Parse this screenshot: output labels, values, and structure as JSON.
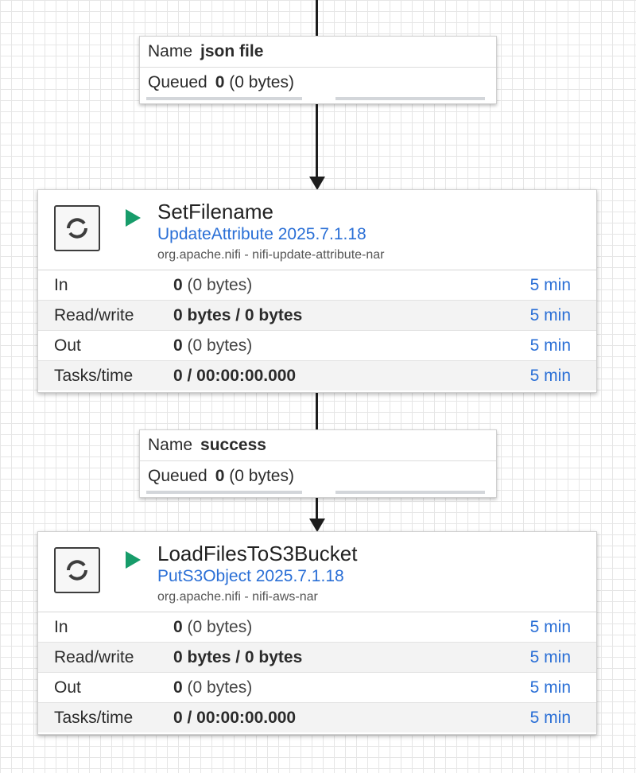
{
  "connections": [
    {
      "name_label": "Name",
      "name": "json file",
      "queued_label": "Queued",
      "queued_count": "0",
      "queued_size": "(0 bytes)"
    },
    {
      "name_label": "Name",
      "name": "success",
      "queued_label": "Queued",
      "queued_count": "0",
      "queued_size": "(0 bytes)"
    }
  ],
  "processors": [
    {
      "name": "SetFilename",
      "type": "UpdateAttribute 2025.7.1.18",
      "bundle": "org.apache.nifi - nifi-update-attribute-nar",
      "status": "running",
      "icon": "processor-icon",
      "stats": {
        "in": {
          "label": "In",
          "count": "0",
          "size": "(0 bytes)",
          "time": "5 min"
        },
        "rw": {
          "label": "Read/write",
          "value": "0 bytes / 0 bytes",
          "time": "5 min"
        },
        "out": {
          "label": "Out",
          "count": "0",
          "size": "(0 bytes)",
          "time": "5 min"
        },
        "tasks": {
          "label": "Tasks/time",
          "value": "0 / 00:00:00.000",
          "time": "5 min"
        }
      }
    },
    {
      "name": "LoadFilesToS3Bucket",
      "type": "PutS3Object 2025.7.1.18",
      "bundle": "org.apache.nifi - nifi-aws-nar",
      "status": "running",
      "icon": "processor-icon",
      "stats": {
        "in": {
          "label": "In",
          "count": "0",
          "size": "(0 bytes)",
          "time": "5 min"
        },
        "rw": {
          "label": "Read/write",
          "value": "0 bytes / 0 bytes",
          "time": "5 min"
        },
        "out": {
          "label": "Out",
          "count": "0",
          "size": "(0 bytes)",
          "time": "5 min"
        },
        "tasks": {
          "label": "Tasks/time",
          "value": "0 / 00:00:00.000",
          "time": "5 min"
        }
      }
    }
  ],
  "colors": {
    "run": "#179c6a",
    "link": "#2a6fd6",
    "edge": "#1d1d1d"
  }
}
